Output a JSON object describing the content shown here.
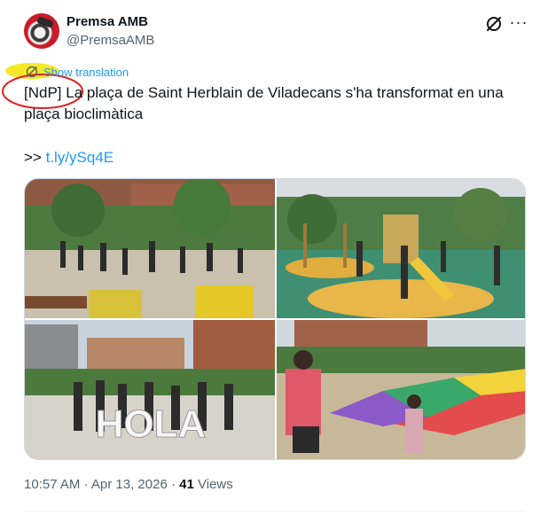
{
  "author": {
    "display_name": "Premsa AMB",
    "handle": "@PremsaAMB"
  },
  "icons": {
    "grok": "grok-icon",
    "more": "more-icon",
    "translate": "translate-icon"
  },
  "actions": {
    "show_translation": "Show translation",
    "more_glyph": "···"
  },
  "tweet": {
    "text_line1": "[NdP] La plaça de Saint Herblain de Viladecans s'ha transformat en una",
    "text_line2": "plaça bioclimàtica",
    "link_prefix": ">>",
    "link_text": "t.ly/ySq4E"
  },
  "media": {
    "photo3_sign": "HOLA"
  },
  "meta": {
    "time": "10:57 AM",
    "separator1": "·",
    "date": "Apr 13, 2026",
    "separator2": "·",
    "views_count": "41",
    "views_label": "Views"
  },
  "colors": {
    "accent": "#1d9bf0",
    "highlight_marker": "#f5e400",
    "annotation_circle": "#e02020"
  }
}
